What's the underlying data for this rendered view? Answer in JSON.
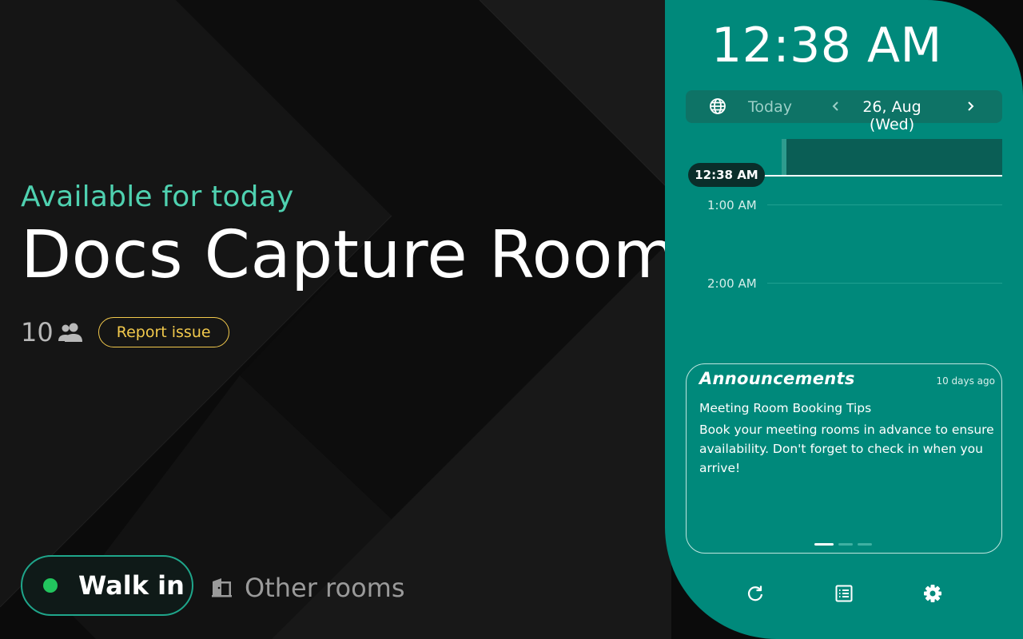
{
  "room": {
    "availability": "Available for today",
    "name": "Docs Capture Room",
    "capacity": "10",
    "report_label": "Report issue"
  },
  "actions": {
    "walk_in_label": "Walk in",
    "other_rooms_label": "Other rooms"
  },
  "panel": {
    "clock": "12:38 AM",
    "date_nav": {
      "today_label": "Today",
      "date": "26, Aug (Wed)"
    },
    "timeline": {
      "now_label": "12:38 AM",
      "hours": [
        "1:00 AM",
        "2:00 AM"
      ]
    },
    "announcements": {
      "title": "Announcements",
      "time": "10 days ago",
      "heading": "Meeting Room Booking Tips",
      "body": "Book your meeting rooms in advance to ensure availability. Don't forget to check in when you arrive!",
      "pages": 3,
      "active_page": 1
    },
    "footer_icons": [
      "refresh-icon",
      "list-icon",
      "settings-icon"
    ]
  },
  "colors": {
    "accent": "#00897b",
    "availability": "#4fd1b0",
    "report": "#f2c94c",
    "status_dot": "#22c55e"
  }
}
